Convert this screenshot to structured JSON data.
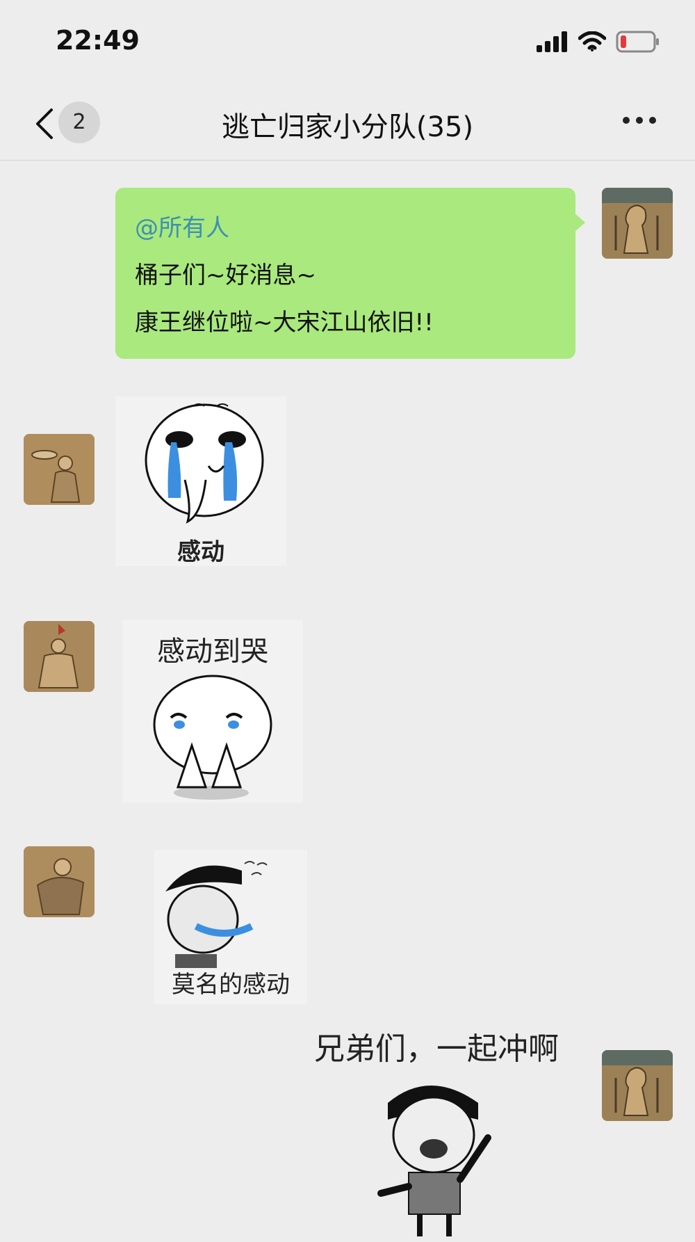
{
  "status": {
    "time": "22:49"
  },
  "nav": {
    "badge_count": "2",
    "title": "逃亡归家小分队(35)"
  },
  "messages": [
    {
      "mention": "@所有人",
      "line1": "桶子们~好消息~",
      "line2": "康王继位啦~大宋江山依旧!!"
    },
    {
      "sticker_caption": "感动"
    },
    {
      "sticker_caption": "感动到哭"
    },
    {
      "sticker_caption": "莫名的感动"
    },
    {
      "sticker_caption": "兄弟们，一起冲啊"
    }
  ],
  "colors": {
    "bubble": "#a9e97d",
    "mention": "#3e8fb3",
    "background": "#ededed"
  }
}
